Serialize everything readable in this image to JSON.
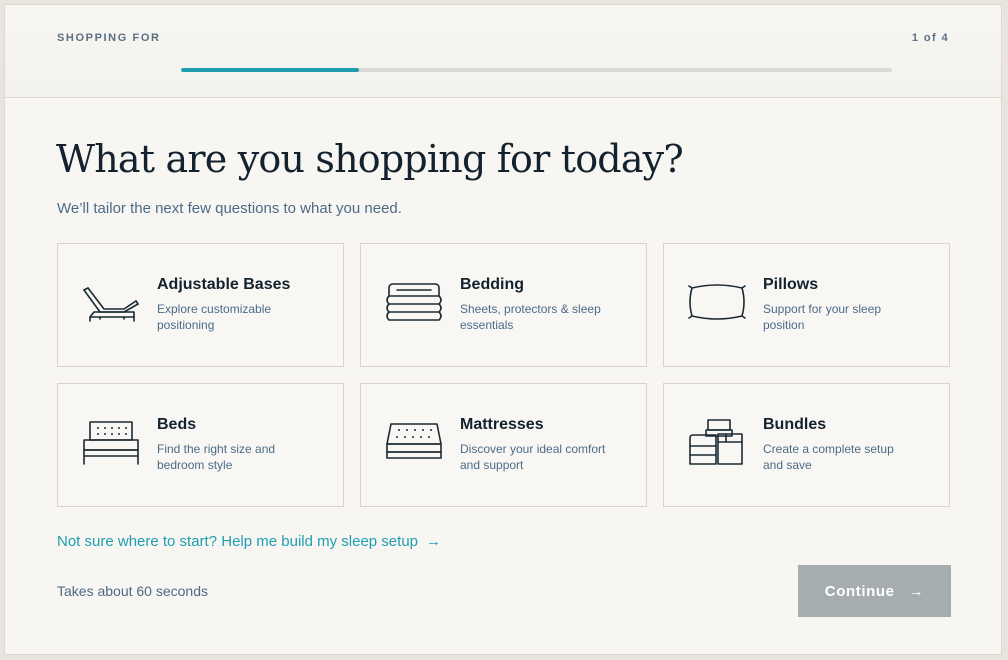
{
  "header": {
    "step_label": "SHOPPING FOR",
    "step_count": "1 of 4",
    "progress_fraction": 0.25
  },
  "main": {
    "title": "What are you shopping for today?",
    "subtitle": "We’ll tailor the next few questions to what you need."
  },
  "categories": [
    {
      "title": "Adjustable Bases",
      "description": "Explore customizable positioning",
      "icon": "adjustable-base-icon"
    },
    {
      "title": "Bedding",
      "description": "Sheets, protectors & sleep essentials",
      "icon": "bedding-icon"
    },
    {
      "title": "Pillows",
      "description": "Support for your sleep position",
      "icon": "pillow-icon"
    },
    {
      "title": "Beds",
      "description": "Find the right size and bedroom style",
      "icon": "bed-icon"
    },
    {
      "title": "Mattresses",
      "description": "Discover your ideal comfort and support",
      "icon": "mattress-icon"
    },
    {
      "title": "Bundles",
      "description": "Create a complete setup and save",
      "icon": "bundle-icon"
    }
  ],
  "footer": {
    "help_link": "Not sure where to start? Help me build my sleep setup",
    "help_arrow": "→",
    "time_note": "Takes about 60 seconds",
    "continue_label": "Continue",
    "continue_arrow": "→"
  },
  "colors": {
    "accent": "#1f9eb0",
    "title": "#13222e",
    "muted": "#4c6b87",
    "button_disabled": "#a6adb1",
    "background": "#f7f6f2"
  }
}
